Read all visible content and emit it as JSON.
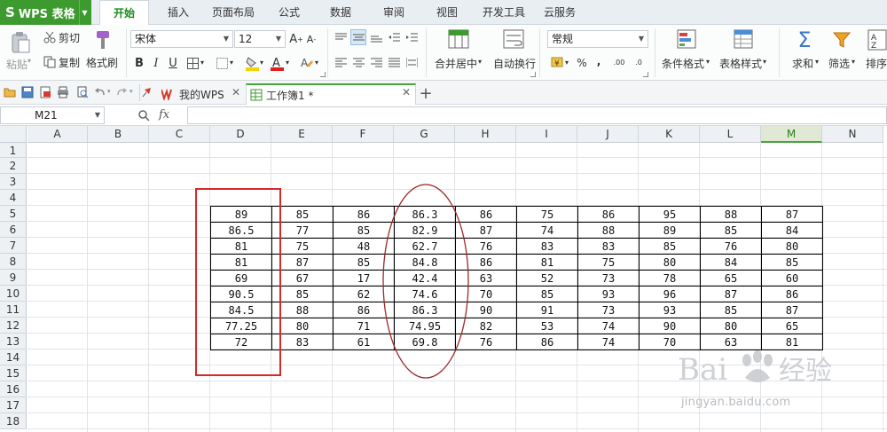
{
  "app": {
    "logo": "S",
    "name": "WPS 表格"
  },
  "menu_tabs": [
    "开始",
    "插入",
    "页面布局",
    "公式",
    "数据",
    "审阅",
    "视图",
    "开发工具",
    "云服务"
  ],
  "ribbon": {
    "clipboard": {
      "paste": "粘贴",
      "cut": "剪切",
      "copy": "复制",
      "format_painter": "格式刷"
    },
    "font_name": "宋体",
    "font_size": "12",
    "font_buttons": [
      "B",
      "I",
      "U"
    ],
    "merge_center": "合并居中",
    "auto_wrap": "自动换行",
    "number_format": "常规",
    "conditional_format": "条件格式",
    "table_style": "表格样式",
    "sum": "求和",
    "filter": "筛选",
    "sort": "排序",
    "percent": "%",
    "comma": ",",
    "dec_inc": ".00",
    "dec_dec": ".0"
  },
  "doc_tabs": {
    "my_wps": "我的WPS",
    "workbook": "工作簿1 *",
    "add": "+"
  },
  "formula_bar": {
    "cell_ref": "M21",
    "fx": "fx"
  },
  "columns": [
    "A",
    "B",
    "C",
    "D",
    "E",
    "F",
    "G",
    "H",
    "I",
    "J",
    "K",
    "L",
    "M",
    "N"
  ],
  "selected_column": "M",
  "rows": [
    "1",
    "2",
    "3",
    "4",
    "5",
    "6",
    "7",
    "8",
    "9",
    "10",
    "11",
    "12",
    "13",
    "14",
    "15",
    "16",
    "17",
    "18"
  ],
  "table": [
    [
      "89",
      "85",
      "86",
      "86.3",
      "86",
      "75",
      "86",
      "95",
      "88",
      "87"
    ],
    [
      "86.5",
      "77",
      "85",
      "82.9",
      "87",
      "74",
      "88",
      "89",
      "85",
      "84"
    ],
    [
      "81",
      "75",
      "48",
      "62.7",
      "76",
      "83",
      "83",
      "85",
      "76",
      "80"
    ],
    [
      "81",
      "87",
      "85",
      "84.8",
      "86",
      "81",
      "75",
      "80",
      "84",
      "85"
    ],
    [
      "69",
      "67",
      "17",
      "42.4",
      "63",
      "52",
      "73",
      "78",
      "65",
      "60"
    ],
    [
      "90.5",
      "85",
      "62",
      "74.6",
      "70",
      "85",
      "93",
      "96",
      "87",
      "86"
    ],
    [
      "84.5",
      "88",
      "86",
      "86.3",
      "90",
      "91",
      "73",
      "93",
      "85",
      "87"
    ],
    [
      "77.25",
      "80",
      "71",
      "74.95",
      "82",
      "53",
      "74",
      "90",
      "80",
      "65"
    ],
    [
      "72",
      "83",
      "61",
      "69.8",
      "76",
      "86",
      "74",
      "70",
      "63",
      "81"
    ]
  ],
  "annotation_colors": {
    "rect": "#d42a2a",
    "ellipse": "#9c2a2a"
  },
  "watermark": {
    "url": "jingyan.baidu.com"
  },
  "accent": "#3d9a2f"
}
